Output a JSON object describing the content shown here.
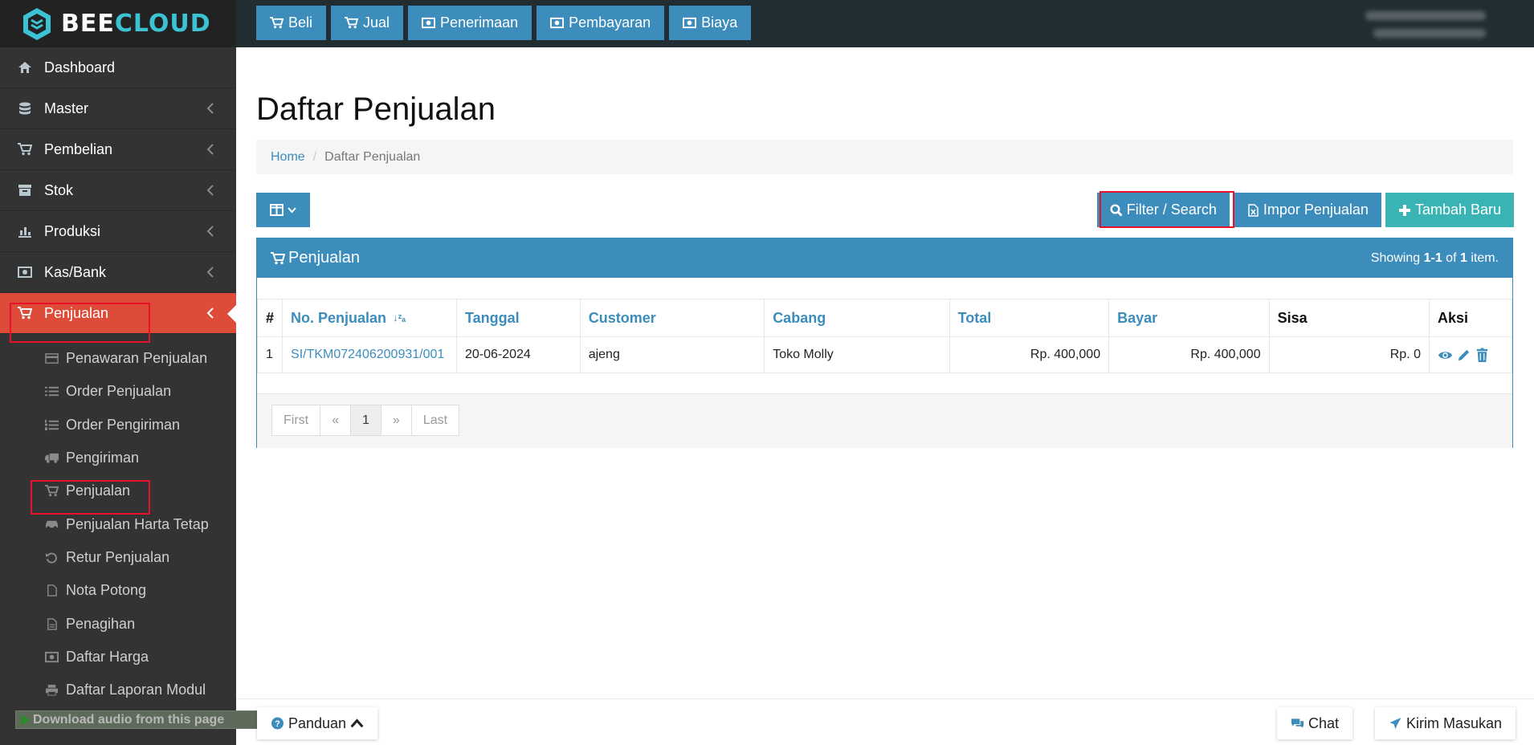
{
  "brand": {
    "part1": "BEE",
    "part2": "CLOUD"
  },
  "topnav": [
    {
      "label": "Beli",
      "icon": "cart-icon"
    },
    {
      "label": "Jual",
      "icon": "cart-icon"
    },
    {
      "label": "Penerimaan",
      "icon": "money-icon"
    },
    {
      "label": "Pembayaran",
      "icon": "money-icon"
    },
    {
      "label": "Biaya",
      "icon": "money-icon"
    }
  ],
  "sidebar": {
    "items": [
      {
        "label": "Dashboard",
        "icon": "home-icon"
      },
      {
        "label": "Master",
        "icon": "database-icon"
      },
      {
        "label": "Pembelian",
        "icon": "cart-icon"
      },
      {
        "label": "Stok",
        "icon": "archive-icon"
      },
      {
        "label": "Produksi",
        "icon": "bar-chart-icon"
      },
      {
        "label": "Kas/Bank",
        "icon": "money-icon"
      },
      {
        "label": "Penjualan",
        "icon": "cart-icon"
      }
    ],
    "sub_items": [
      {
        "label": "Penawaran Penjualan",
        "icon": "credit-card-icon"
      },
      {
        "label": "Order Penjualan",
        "icon": "list-icon"
      },
      {
        "label": "Order Pengiriman",
        "icon": "list-ordered-icon"
      },
      {
        "label": "Pengiriman",
        "icon": "truck-icon"
      },
      {
        "label": "Penjualan",
        "icon": "cart-icon"
      },
      {
        "label": "Penjualan Harta Tetap",
        "icon": "car-icon"
      },
      {
        "label": "Retur Penjualan",
        "icon": "undo-icon"
      },
      {
        "label": "Nota Potong",
        "icon": "file-icon"
      },
      {
        "label": "Penagihan",
        "icon": "file-text-icon"
      },
      {
        "label": "Daftar Harga",
        "icon": "money-icon"
      },
      {
        "label": "Daftar Laporan Modul",
        "icon": "print-icon"
      }
    ]
  },
  "page": {
    "title": "Daftar Penjualan",
    "breadcrumb": {
      "home": "Home",
      "separator": "/",
      "current": "Daftar Penjualan"
    }
  },
  "toolbar": {
    "filter_label": "Filter / Search",
    "import_label": "Impor Penjualan",
    "add_label": "Tambah Baru"
  },
  "panel": {
    "title": "Penjualan",
    "summary_prefix": "Showing ",
    "summary_range": "1-1",
    "summary_mid": " of ",
    "summary_total": "1",
    "summary_suffix": " item."
  },
  "table": {
    "headers": [
      "#",
      "No. Penjualan",
      "Tanggal",
      "Customer",
      "Cabang",
      "Total",
      "Bayar",
      "Sisa",
      "Aksi"
    ],
    "sort_indicator": "↓ᶻₐ",
    "rows": [
      {
        "no": "1",
        "nomor": "SI/TKM072406200931/001",
        "tanggal": "20-06-2024",
        "customer": "ajeng",
        "cabang": "Toko Molly",
        "total": "Rp. 400,000",
        "bayar": "Rp. 400,000",
        "sisa": "Rp. 0"
      }
    ]
  },
  "pagination": [
    "First",
    "«",
    "1",
    "»",
    "Last"
  ],
  "footer": {
    "panduan_label": "Panduan",
    "chat_label": "Chat",
    "feedback_label": "Kirim Masukan",
    "audio_label": "Download audio from this page"
  },
  "colors": {
    "primary": "#3c8dbc",
    "active": "#dd4b39",
    "teal": "#39b3b3",
    "sidebar": "#333333",
    "header": "#222d32"
  }
}
